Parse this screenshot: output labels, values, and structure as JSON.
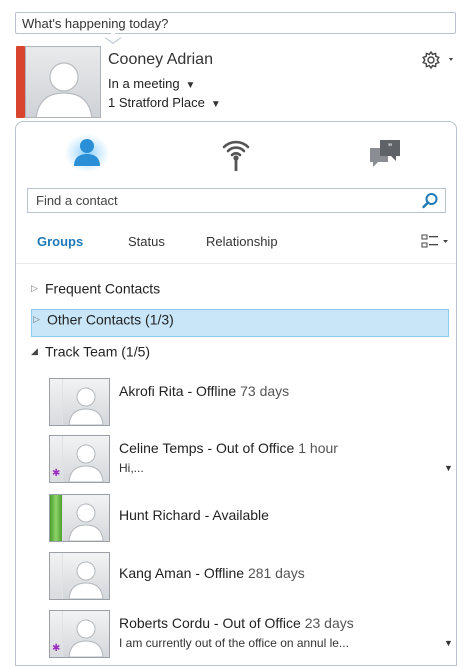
{
  "status_input": {
    "value": "What's happening today?"
  },
  "user": {
    "name": "Cooney Adrian",
    "status": "In a meeting",
    "location": "1 Stratford Place",
    "presence_color": "#d8442e"
  },
  "icons": {
    "settings": "gear-icon",
    "contacts": "contacts-icon",
    "presence_feed": "wireless-icon",
    "conversations": "chat-bubbles-icon",
    "search": "search-icon",
    "view_options": "list-view-icon"
  },
  "search": {
    "placeholder": "Find a contact"
  },
  "tabs": [
    {
      "label": "Groups"
    },
    {
      "label": "Status"
    },
    {
      "label": "Relationship"
    }
  ],
  "groups": [
    {
      "label": "Frequent Contacts",
      "expanded": false
    },
    {
      "label": "Other Contacts (1/3)",
      "expanded": false,
      "selected": true
    },
    {
      "label": "Track Team (1/5)",
      "expanded": true
    }
  ],
  "contacts": [
    {
      "name": "Akrofi Rita - Offline",
      "duration": "73 days",
      "note": "",
      "presence": "offline"
    },
    {
      "name": "Celine Temps  - Out of Office",
      "duration": "1 hour",
      "note": "Hi,...",
      "presence": "out-of-office"
    },
    {
      "name": "Hunt Richard - Available",
      "duration": "",
      "note": "",
      "presence": "available"
    },
    {
      "name": "Kang Aman - Offline",
      "duration": "281 days",
      "note": "",
      "presence": "offline"
    },
    {
      "name": "Roberts Cordu - Out of Office",
      "duration": "23 days",
      "note": "I am currently out of the office on annul le...",
      "presence": "out-of-office"
    }
  ],
  "colors": {
    "accent": "#1e7ab8",
    "selected_row": "#c8e6f7",
    "available": "#4aa02c",
    "busy": "#d8442e",
    "out_of_office": "#9b2fc0"
  }
}
